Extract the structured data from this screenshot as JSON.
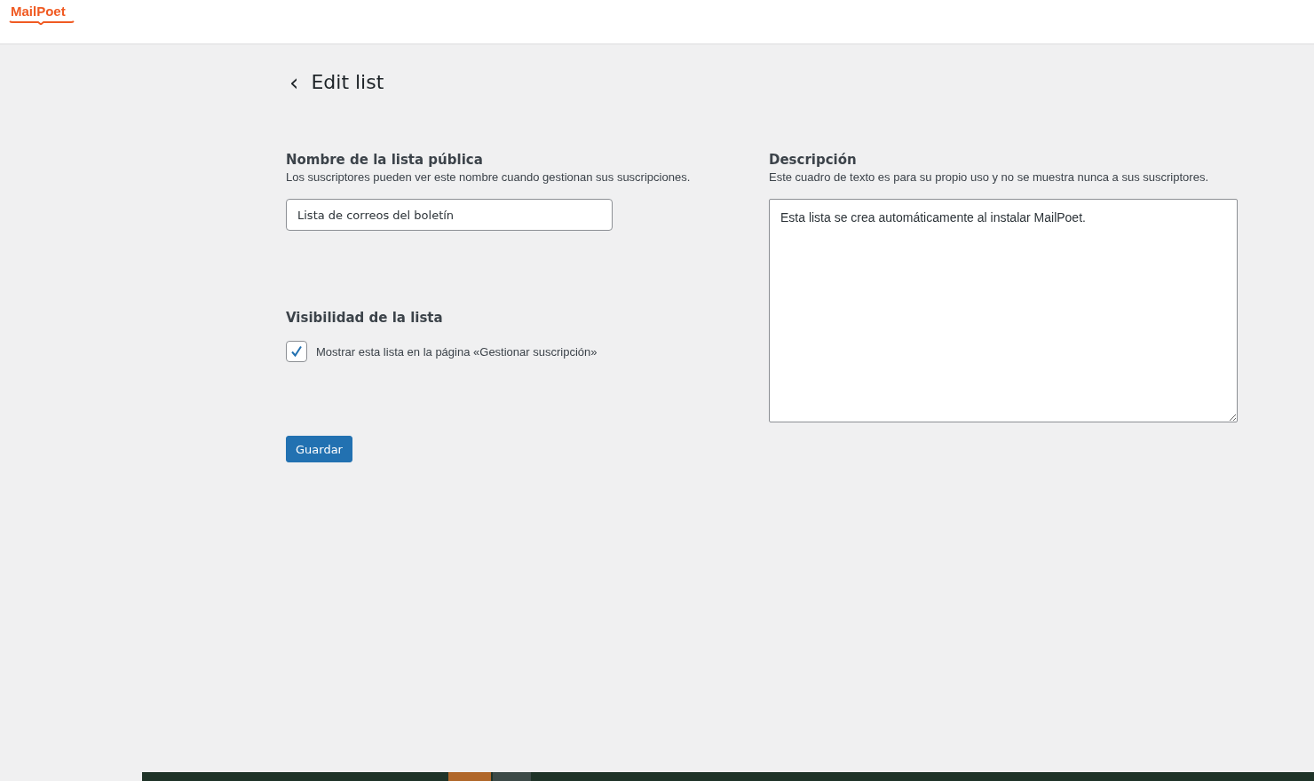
{
  "header": {
    "logo": "MailPoet"
  },
  "page": {
    "back_icon": "‹",
    "title": "Edit list"
  },
  "name_field": {
    "label": "Nombre de la lista pública",
    "help": "Los suscriptores pueden ver este nombre cuando gestionan sus suscripciones.",
    "value": "Lista de correos del boletín"
  },
  "visibility": {
    "label": "Visibilidad de la lista",
    "checkbox": {
      "label": "Mostrar esta lista en la página «Gestionar suscripción»",
      "checked": true
    }
  },
  "description_field": {
    "label": "Descripción",
    "help": "Este cuadro de texto es para su propio uso y no se muestra nunca a sus suscriptores.",
    "value": "Esta lista se crea automáticamente al instalar MailPoet."
  },
  "buttons": [
    {
      "label": "Guardar",
      "kind": "primary"
    }
  ]
}
